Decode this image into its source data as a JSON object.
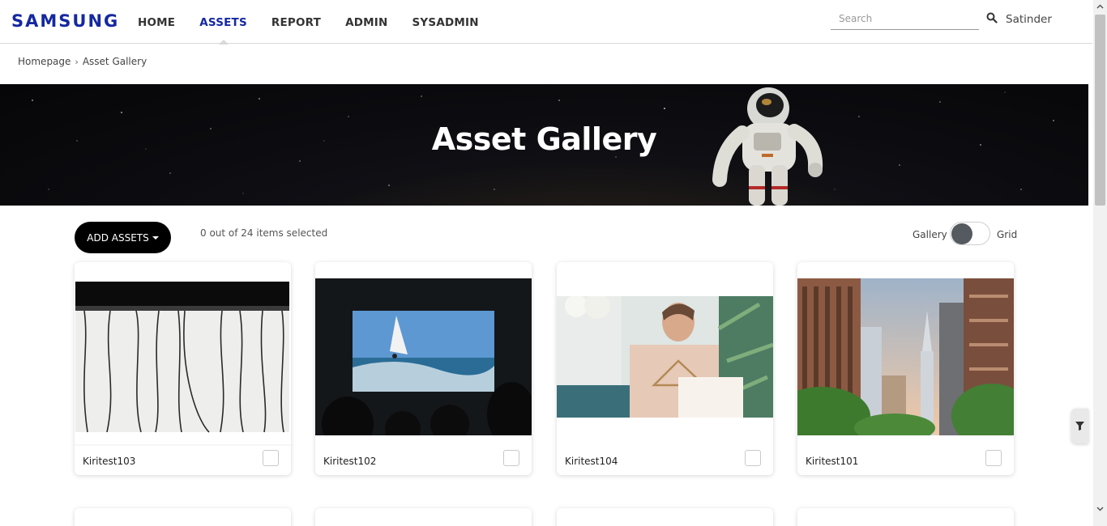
{
  "brand": {
    "logo": "SAMSUNG",
    "color": "#1428a0"
  },
  "nav": {
    "items": [
      {
        "label": "HOME",
        "active": false
      },
      {
        "label": "ASSETS",
        "active": true
      },
      {
        "label": "REPORT",
        "active": false
      },
      {
        "label": "ADMIN",
        "active": false
      },
      {
        "label": "SYSADMIN",
        "active": false
      }
    ]
  },
  "search": {
    "placeholder": "Search",
    "value": "",
    "icon": "search-icon"
  },
  "user": {
    "name": "Satinder"
  },
  "breadcrumb": {
    "home": "Homepage",
    "separator": "›",
    "current": "Asset Gallery"
  },
  "hero": {
    "title": "Asset Gallery"
  },
  "toolbar": {
    "add_label": "ADD ASSETS",
    "selected_text": "0 out of 24 items selected",
    "view_left": "Gallery",
    "view_right": "Grid",
    "view_mode": "Gallery"
  },
  "cards": [
    {
      "title": "Kiritest103",
      "checked": false
    },
    {
      "title": "Kiritest102",
      "checked": false
    },
    {
      "title": "Kiritest104",
      "checked": false
    },
    {
      "title": "Kiritest101",
      "checked": false
    }
  ],
  "filter": {
    "icon": "filter-icon"
  }
}
